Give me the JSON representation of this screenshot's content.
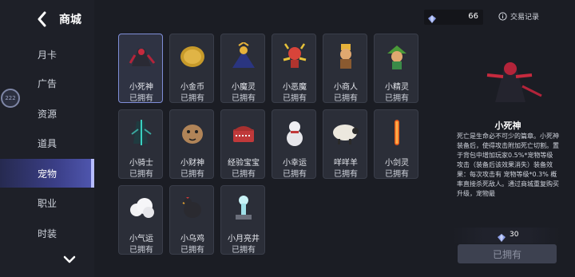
{
  "header": {
    "title": "商城"
  },
  "nav": {
    "items": [
      {
        "label": "月卡",
        "active": false
      },
      {
        "label": "广告",
        "active": false
      },
      {
        "label": "资源",
        "active": false
      },
      {
        "label": "道具",
        "active": false
      },
      {
        "label": "宠物",
        "active": true
      },
      {
        "label": "职业",
        "active": false
      },
      {
        "label": "时装",
        "active": false
      }
    ]
  },
  "floating_button": {
    "label": "222"
  },
  "currency": {
    "amount": "66",
    "icon": "gem-icon"
  },
  "trade_record": {
    "label": "交易记录",
    "icon": "info-icon"
  },
  "pets": [
    {
      "name": "小死神",
      "status": "已拥有",
      "icon": "reaper-pet-icon",
      "color": "#b3243a"
    },
    {
      "name": "小金币",
      "status": "已拥有",
      "icon": "gold-coin-pet-icon",
      "color": "#c79a2a"
    },
    {
      "name": "小魔灵",
      "status": "已拥有",
      "icon": "wizard-pet-icon",
      "color": "#3b4aa8"
    },
    {
      "name": "小恶魔",
      "status": "已拥有",
      "icon": "demon-pet-icon",
      "color": "#d8443a"
    },
    {
      "name": "小商人",
      "status": "已拥有",
      "icon": "merchant-pet-icon",
      "color": "#d99a3a"
    },
    {
      "name": "小精灵",
      "status": "已拥有",
      "icon": "elf-pet-icon",
      "color": "#5aa844"
    },
    {
      "name": "小骑士",
      "status": "已拥有",
      "icon": "knight-pet-icon",
      "color": "#3aa8a0"
    },
    {
      "name": "小财神",
      "status": "已拥有",
      "icon": "fortune-pet-icon",
      "color": "#b08458"
    },
    {
      "name": "经验宝宝",
      "status": "已拥有",
      "icon": "chest-pet-icon",
      "color": "#c0393a"
    },
    {
      "name": "小幸运",
      "status": "已拥有",
      "icon": "snowman-pet-icon",
      "color": "#e6e6ea"
    },
    {
      "name": "咩咩羊",
      "status": "已拥有",
      "icon": "sheep-pet-icon",
      "color": "#e8e4da"
    },
    {
      "name": "小剑灵",
      "status": "已拥有",
      "icon": "sword-pet-icon",
      "color": "#e85a1a"
    },
    {
      "name": "小气运",
      "status": "已拥有",
      "icon": "cloud-pet-icon",
      "color": "#f2f2f4"
    },
    {
      "name": "小乌鸡",
      "status": "已拥有",
      "icon": "chicken-pet-icon",
      "color": "#2a2a30"
    },
    {
      "name": "小月亮井",
      "status": "已拥有",
      "icon": "moonwell-pet-icon",
      "color": "#9fe0e8"
    }
  ],
  "detail": {
    "name": "小死神",
    "icon": "reaper-pet-icon",
    "description": "死亡是生命必不可少的篇章。小死神装备后，使得攻击附加死亡切割。置于背包中增加玩家0.5%*宠物等级攻击（装备后该效果消失）装备效果：每次攻击有 宠物等级*0.3% 概率直接杀死敌人。通过商城重复购买升级，宠物最",
    "price": "30",
    "button_label": "已拥有"
  }
}
